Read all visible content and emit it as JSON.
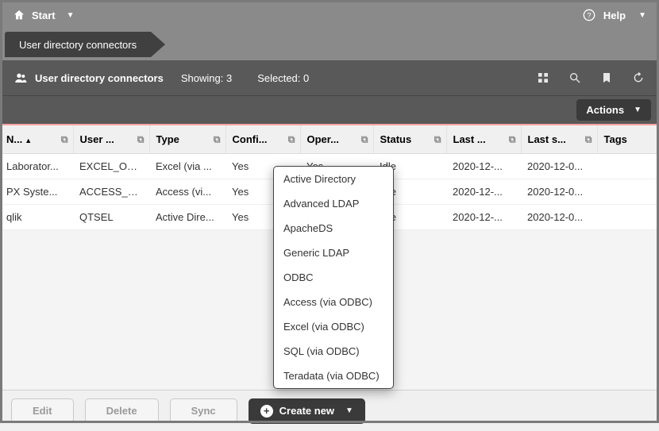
{
  "topbar": {
    "start": "Start",
    "help": "Help"
  },
  "breadcrumb": {
    "current": "User directory connectors"
  },
  "section": {
    "title": "User directory connectors",
    "showing_label": "Showing:",
    "showing_count": "3",
    "selected_label": "Selected:",
    "selected_count": "0",
    "actions": "Actions"
  },
  "columns": {
    "name": "N...",
    "user": "User ...",
    "type": "Type",
    "config": "Confi...",
    "oper": "Oper...",
    "status": "Status",
    "last": "Last ...",
    "lasts": "Last s...",
    "tags": "Tags"
  },
  "rows": [
    {
      "name": "Laborator...",
      "user": "EXCEL_OD...",
      "type": "Excel (via ...",
      "config": "Yes",
      "oper": "Yes",
      "status": "Idle",
      "last": "2020-12-...",
      "lasts": "2020-12-0...",
      "tags": ""
    },
    {
      "name": "PX Syste...",
      "user": "ACCESS_O...",
      "type": "Access (vi...",
      "config": "Yes",
      "oper": "",
      "status": "Idle",
      "last": "2020-12-...",
      "lasts": "2020-12-0...",
      "tags": ""
    },
    {
      "name": "qlik",
      "user": "QTSEL",
      "type": "Active Dire...",
      "config": "Yes",
      "oper": "",
      "status": "Idle",
      "last": "2020-12-...",
      "lasts": "2020-12-0...",
      "tags": ""
    }
  ],
  "dropdown": {
    "items": [
      "Active Directory",
      "Advanced LDAP",
      "ApacheDS",
      "Generic LDAP",
      "ODBC",
      "Access (via ODBC)",
      "Excel (via ODBC)",
      "SQL (via ODBC)",
      "Teradata (via ODBC)"
    ]
  },
  "footer": {
    "edit": "Edit",
    "delete": "Delete",
    "sync": "Sync",
    "create": "Create new"
  }
}
